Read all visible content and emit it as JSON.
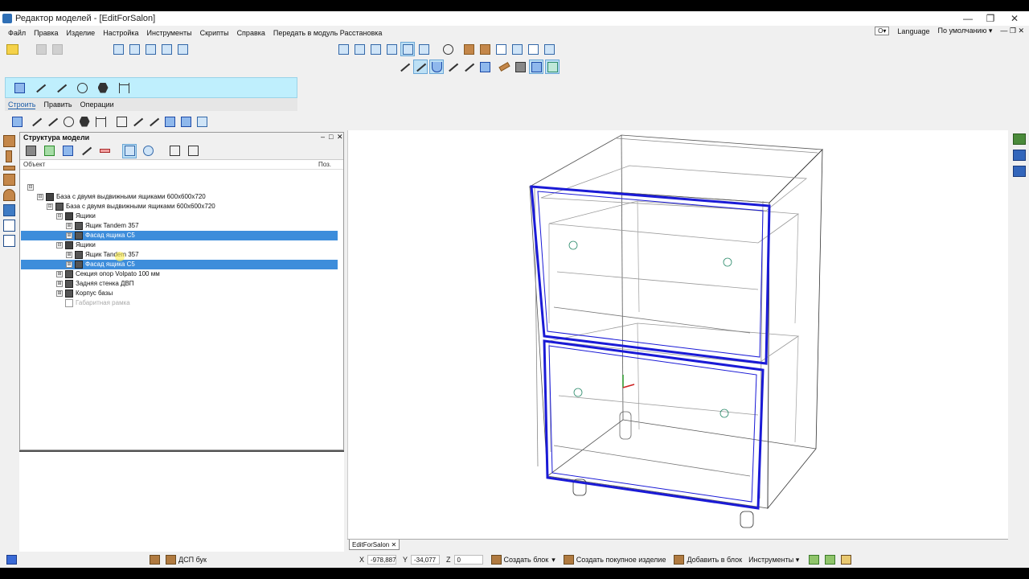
{
  "window": {
    "title": "Редактор моделей - [EditForSalon]",
    "controls": [
      "—",
      "❐",
      "✕"
    ]
  },
  "menu": {
    "items": [
      "Файл",
      "Правка",
      "Изделие",
      "Настройка",
      "Инструменты",
      "Скрипты",
      "Справка",
      "Передать в модуль Расстановка"
    ],
    "right": {
      "language": "Language",
      "preset": "По умолчанию",
      "key_icon": "key-icon"
    }
  },
  "build_panel": {
    "tabs": [
      "Строить",
      "Править",
      "Операции"
    ],
    "active_tab": "Строить"
  },
  "structure_panel": {
    "title": "Структура модели",
    "columns": {
      "object": "Объект",
      "pos": "Поз."
    },
    "rows": [
      {
        "indent": 0,
        "label": "",
        "toggle": "⊟",
        "icon": "none"
      },
      {
        "indent": 1,
        "label": "База с двумя выдвижными ящиками 600x600x720",
        "toggle": "⊟",
        "icon": "box"
      },
      {
        "indent": 2,
        "label": "База с двумя выдвижными ящиками 600x600x720",
        "toggle": "⊟",
        "icon": "part"
      },
      {
        "indent": 3,
        "label": "Ящики",
        "toggle": "⊟",
        "icon": "box"
      },
      {
        "indent": 4,
        "label": "Ящик Tandem 357",
        "toggle": "⊞",
        "icon": "part"
      },
      {
        "indent": 4,
        "label": "Фасад ящика С5",
        "toggle": "⊞",
        "icon": "part",
        "selected": true
      },
      {
        "indent": 3,
        "label": "Ящики",
        "toggle": "⊟",
        "icon": "box"
      },
      {
        "indent": 4,
        "label": "Ящик Tandem 357",
        "toggle": "⊞",
        "icon": "part"
      },
      {
        "indent": 4,
        "label": "Фасад ящика С5",
        "toggle": "⊞",
        "icon": "part",
        "selected": true
      },
      {
        "indent": 3,
        "label": "Секция опор Volpato 100 мм",
        "toggle": "⊞",
        "icon": "part"
      },
      {
        "indent": 3,
        "label": "Задняя стенка ДВП",
        "toggle": "⊞",
        "icon": "part"
      },
      {
        "indent": 3,
        "label": "Корпус базы",
        "toggle": "⊞",
        "icon": "part"
      },
      {
        "indent": 3,
        "label": "Габаритная рамка",
        "toggle": "",
        "icon": "frame",
        "gray": true
      }
    ]
  },
  "document_tab": "EditForSalon",
  "statusbar": {
    "material": "ДСП бук",
    "x_label": "X",
    "x_value": "-978,887",
    "y_label": "Y",
    "y_value": "-34,077",
    "z_label": "Z",
    "z_value": "0",
    "create_block": "Создать блок",
    "create_purchased": "Создать покупное изделие",
    "add_to_block": "Добавить в блок",
    "tools": "Инструменты"
  },
  "colors": {
    "selection": "#3d8ddb",
    "facade_highlight": "#1a1ad6",
    "build_strip": "#bfeffd"
  }
}
